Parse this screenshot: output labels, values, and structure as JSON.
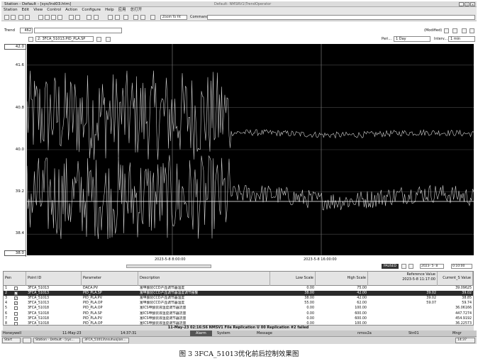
{
  "window": {
    "title": "Station - Default - [sys/Ind03.htm]",
    "center_title": "Default: NMSRV1\\TrendOperator"
  },
  "menu": [
    "Station",
    "Edit",
    "View",
    "Control",
    "Action",
    "Configure",
    "Help",
    "应用",
    "总打开"
  ],
  "toolbar": {
    "zoom_label": "Zoom To Fit",
    "command_label": "Command"
  },
  "trend": {
    "label": "Trend",
    "number": "462",
    "modified": "(Modified)"
  },
  "point_selector": "2: 3FCA_51013.PID_PLA.SP",
  "period": {
    "label": "Peri...",
    "value": "1 Day"
  },
  "interval": {
    "label": "Interv...",
    "value": "1 min"
  },
  "chart_data": {
    "type": "line",
    "yticks": [
      "42.0",
      "41.6",
      "40.8",
      "40.0",
      "39.2",
      "38.4",
      "38.0"
    ],
    "ylim": [
      38.0,
      42.0
    ],
    "xticks": [
      "2023-5-8 8:00:00",
      "2023-5-8 16:00:00"
    ],
    "colors": {
      "background": "#000000",
      "trace": "#cfcfcf",
      "grid": "#4a4a4a"
    }
  },
  "nav": {
    "status": "PAUSED",
    "date": "2023- 5- 8",
    "time": "0:10:00"
  },
  "table": {
    "headers": {
      "pen": "Pen",
      "point_id": "Point ID",
      "parameter": "Parameter",
      "description": "Description",
      "low": "Low Scale",
      "high": "High Scale",
      "ref": "Reference Value",
      "ref_time": "2023-5-8 11:17:00",
      "current": "Current_S Value"
    },
    "rows": [
      {
        "n": "1",
        "checked": false,
        "id": "3FCA_51013",
        "param": "DACA.PV",
        "desc": "富甲酸装CCD产品调节器温度",
        "low": "0.00",
        "high": "75.00",
        "ref": "",
        "cur": "39.09625"
      },
      {
        "n": "2",
        "checked": true,
        "id": "3FCA_51013",
        "param": "PID_PLA.SP",
        "desc": "富甲酸装CCD产品调节器温度调节报警",
        "low": "38.00",
        "high": "42.00",
        "ref": "39.02",
        "cur": "39.02"
      },
      {
        "n": "3",
        "checked": true,
        "id": "3FCA_51013",
        "param": "PID_PLA.PV",
        "desc": "富甲酸装CCD产品调节器温度",
        "low": "38.00",
        "high": "42.00",
        "ref": "39.02",
        "cur": "38.85"
      },
      {
        "n": "4",
        "checked": true,
        "id": "3FCA_51013",
        "param": "PID_PLA.OP",
        "desc": "富甲酸装CCD产品调节器温度",
        "low": "55.00",
        "high": "62.00",
        "ref": "59.07",
        "cur": "59.74"
      },
      {
        "n": "5",
        "checked": false,
        "id": "3FCA_51018",
        "param": "PID_PLA.OP",
        "desc": "富ICS甲酸装液温度调节器流量",
        "low": "0.00",
        "high": "100.00",
        "ref": "",
        "cur": "36.06166"
      },
      {
        "n": "6",
        "checked": false,
        "id": "3FCA_51018",
        "param": "PID_PLA.SP",
        "desc": "富ICS甲酸装液温度调节器流量",
        "low": "0.00",
        "high": "600.00",
        "ref": "",
        "cur": "447.7274"
      },
      {
        "n": "7",
        "checked": false,
        "id": "3FCA_51018",
        "param": "PID_PLA.PV",
        "desc": "富ICS甲酸装液温度调节器流量",
        "low": "0.00",
        "high": "600.00",
        "ref": "",
        "cur": "454.9192"
      },
      {
        "n": "8",
        "checked": false,
        "id": "3FCA_51018",
        "param": "PID_PLA.OP",
        "desc": "富ICS甲酸装液温度调节器流量",
        "low": "0.00",
        "high": "100.00",
        "ref": "",
        "cur": "36.22573"
      }
    ]
  },
  "alarm_line": "11-May-23 02:16:56  NMSV1  File Replication  U 00 Replication #2 failed",
  "status": {
    "user": "Honeywell",
    "date": "11-May-23",
    "time": "14:37:31",
    "alarm": "Alarm",
    "system": "System",
    "message": "Message",
    "server": "nmsv2a",
    "stn": "Stn01",
    "mode": "Mngr"
  },
  "taskbar": {
    "start": "Start",
    "task1": "Station - Default - [sys...",
    "task2": "3FCA_51013\\nsuhuojian...",
    "clock": "14:37"
  },
  "caption": "图 3  3FCA_51013优化前后控制效果图"
}
